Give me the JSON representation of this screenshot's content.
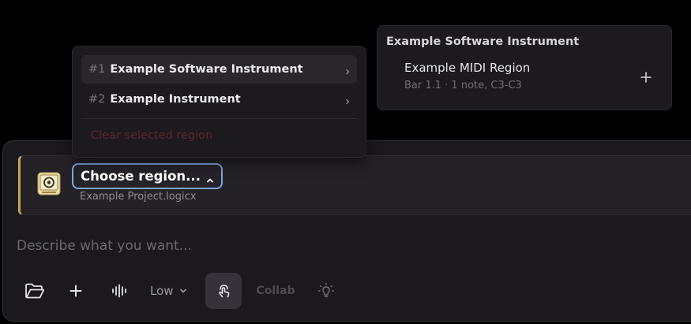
{
  "region_picker": {
    "label": "Choose region...",
    "project_file": "Example Project.logicx"
  },
  "prompt": {
    "placeholder": "Describe what you want..."
  },
  "toolbar": {
    "quality_label": "Low",
    "collab_label": "Collab",
    "icons": [
      "folder-icon",
      "plus-icon",
      "waveform-icon",
      "chevron-down-icon",
      "hand-tap-icon",
      "lightbulb-icon"
    ]
  },
  "dropdown": {
    "tracks": [
      {
        "number": "#1",
        "name": "Example Software Instrument"
      },
      {
        "number": "#2",
        "name": "Example Instrument"
      }
    ],
    "clear_label": "Clear selected region"
  },
  "flyout": {
    "title": "Example Software Instrument",
    "regions": [
      {
        "name": "Example MIDI Region",
        "meta": "Bar 1.1 · 1 note, C3-C3"
      }
    ]
  },
  "colors": {
    "accent_border": "#7fa6df",
    "context_stripe": "#c7a74a",
    "destructive_text": "#5e2629",
    "panel_bg": "#1b191d"
  }
}
